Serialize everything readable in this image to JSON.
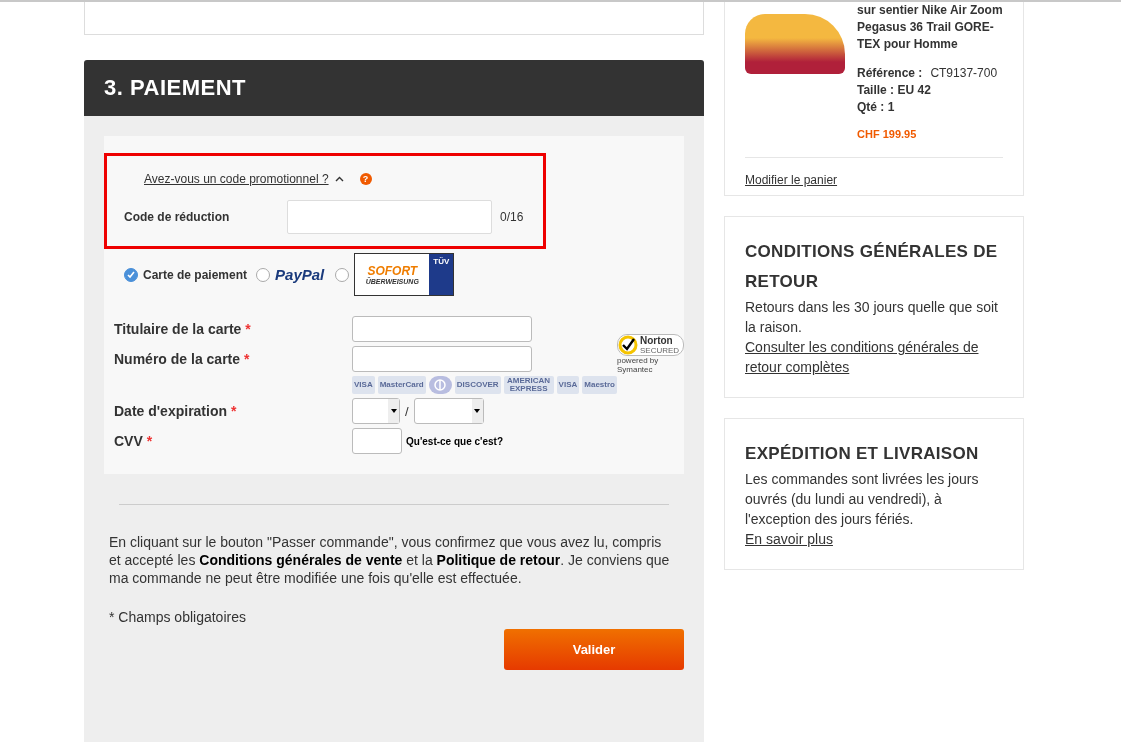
{
  "section": {
    "title": "3. PAIEMENT"
  },
  "promo": {
    "link": "Avez-vous un code promotionnel ?",
    "expanded": true,
    "help": "?",
    "label": "Code de réduction",
    "counter": "0/16"
  },
  "payment_methods": [
    {
      "kind": "card",
      "label": "Carte de paiement",
      "selected": true
    },
    {
      "kind": "paypal",
      "label": "PayPal",
      "selected": false
    },
    {
      "kind": "sofort",
      "label": "SOFORT",
      "sublabel": "ÜBERWEISUNG",
      "badge": "TÜV",
      "selected": false
    }
  ],
  "fields": [
    {
      "kind": "text",
      "label": "Titulaire de la carte",
      "mark": "*"
    },
    {
      "kind": "text",
      "label": "Numéro de la carte",
      "mark": "*"
    },
    {
      "kind": "cards",
      "logos": [
        {
          "kind": "text",
          "text": "VISA"
        },
        {
          "kind": "text",
          "text": "MasterCard"
        },
        {
          "kind": "diners"
        },
        {
          "kind": "text",
          "text": "DISCOVER"
        },
        {
          "kind": "text",
          "text": "AMERICAN EXPRESS"
        },
        {
          "kind": "text",
          "text": "VISA"
        },
        {
          "kind": "text",
          "text": "Maestro"
        }
      ]
    },
    {
      "kind": "expiry",
      "label": "Date d'expiration",
      "mark": "*",
      "separator": "/"
    },
    {
      "kind": "cvv",
      "label": "CVV",
      "mark": "*",
      "help": "Qu'est-ce que c'est?"
    }
  ],
  "norton": {
    "name": "Norton",
    "tag": "SECURED",
    "by": "powered by Symantec"
  },
  "terms": "En cliquant sur le bouton \"Passer commande\", vous confirmez que vous avez lu, compris et accepté les **Conditions générales de vente** et la **Politique de retour**. Je conviens que ma commande ne peut être modifiée une fois qu'elle est effectuée.",
  "required_note": "* Champs obligatoires",
  "submit": "Valider",
  "product": {
    "name": "sur sentier Nike Air Zoom Pegasus 36 Trail GORE-TEX pour Homme",
    "ref_label": "Référence :",
    "ref": "CT9137-700",
    "size": "Taille : EU 42",
    "qty": "Qté : 1",
    "price": "CHF 199.95",
    "edit": "Modifier le panier"
  },
  "info_cards": [
    {
      "title": "CONDITIONS GÉNÉRALES DE RETOUR",
      "text": "Retours dans les 30 jours quelle que soit la raison.",
      "link": "Consulter les conditions générales de retour complètes"
    },
    {
      "title": "EXPÉDITION ET LIVRAISON",
      "text": "Les commandes sont livrées les jours ouvrés (du lundi au vendredi), à l'exception des jours fériés.",
      "link": "En savoir plus"
    }
  ]
}
